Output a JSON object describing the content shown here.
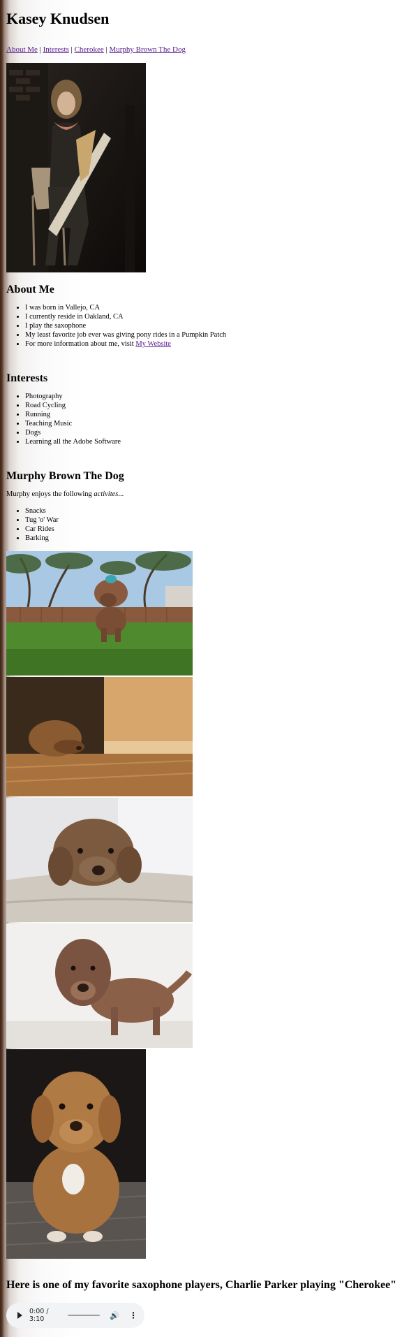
{
  "header": {
    "title": "Kasey Knudsen"
  },
  "nav": {
    "links": [
      "About Me",
      "Interests",
      "Cherokee",
      "Murphy Brown The Dog"
    ],
    "separator": " | "
  },
  "profile_photo": {
    "alt": "Kasey Knudsen playing saxophone"
  },
  "about": {
    "heading": "About Me",
    "items": [
      "I was born in Vallejo, CA",
      "I currently reside in Oakland, CA",
      "I play the saxophone",
      "My least favorite job ever was giving pony rides in a Pumpkin Patch"
    ],
    "more_prefix": "For more information about me, visit ",
    "more_link": "My Website"
  },
  "interests": {
    "heading": "Interests",
    "items": [
      "Photography",
      "Road Cycling",
      "Running",
      "Teaching Music",
      "Dogs",
      "Learning all the Adobe Software"
    ]
  },
  "dog": {
    "heading": "Murphy Brown The Dog",
    "intro_prefix": "Murphy enjoys the following ",
    "intro_emph": "activites",
    "intro_suffix": "...",
    "activities": [
      "Snacks",
      "Tug 'o' War",
      "Car Rides",
      "Barking"
    ]
  },
  "cherokee": {
    "heading": "Here is one of my favorite saxophone players, Charlie Parker playing \"Cherokee\""
  },
  "audio": {
    "time": "0:00 / 3:10",
    "icons": [
      "play-icon",
      "volume-icon",
      "more-options-icon"
    ]
  },
  "colors": {
    "link_visited": "#551a8b",
    "audio_bg": "#f1f3f4"
  }
}
